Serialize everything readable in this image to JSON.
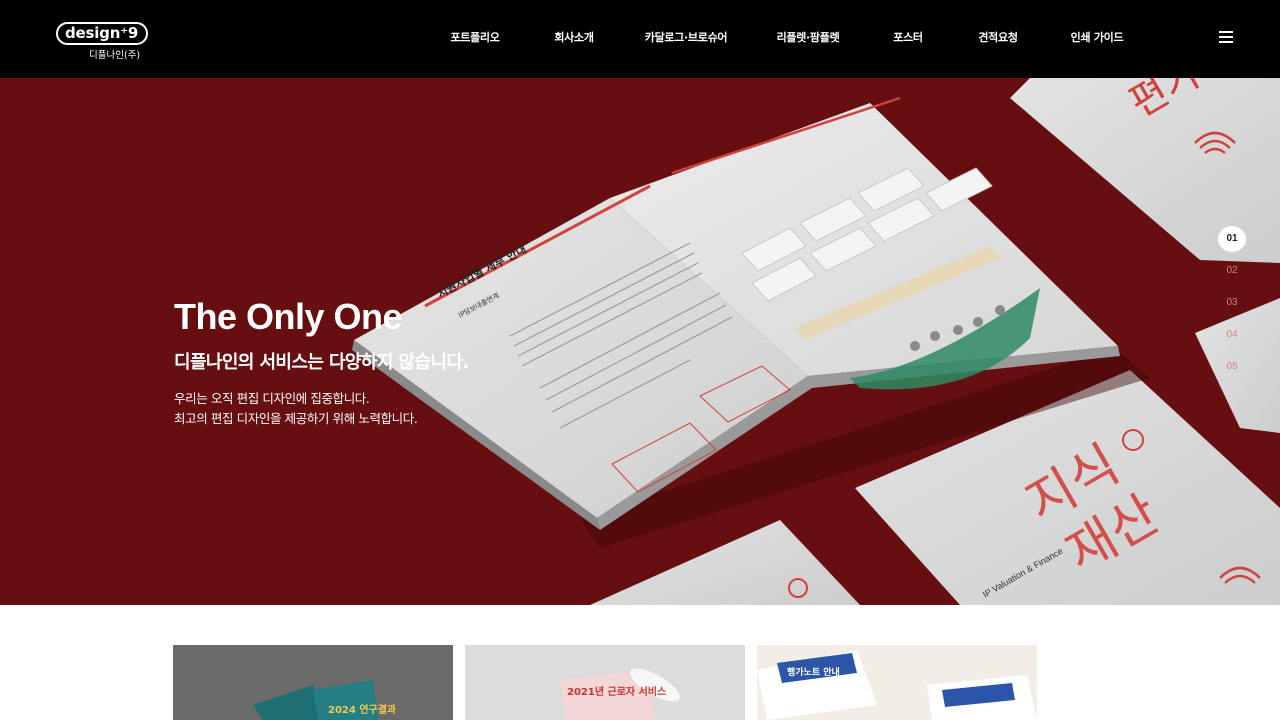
{
  "brand": {
    "logo_text": "design⁺9",
    "logo_subtext": "디플나인(주)"
  },
  "nav": {
    "items": [
      "포트폴리오",
      "회사소개",
      "카달로그·브로슈어",
      "리플렛·팜플렛",
      "포스터",
      "견적요청",
      "인쇄 가이드"
    ],
    "menu_icon": "hamburger-menu-icon"
  },
  "hero": {
    "title": "The Only One",
    "subtitle": "디플나인의 서비스는 다양하지 않습니다.",
    "desc_line1": "우리는 오직 편집 디자인에 집중합니다.",
    "desc_line2": "최고의 편집 디자인을 제공하기 위해 노력합니다.",
    "slides": [
      "01",
      "02",
      "03",
      "04",
      "05"
    ],
    "active_slide": "01",
    "background_color": "#660e10",
    "art_texts": {
      "spread_heading": "지원사업별 세부 안내",
      "spread_sub": "IP담보대출연계",
      "cover_title_en": "IP Valuation & Finance",
      "cover_title_ko": "지식재산 평가지원",
      "cover_big": "지식재산평가"
    }
  },
  "portfolio": {
    "thumbs": [
      {
        "text": "2024 연구결과"
      },
      {
        "text": "2021년 근로자 서비스"
      },
      {
        "text": "행가노트 안내"
      }
    ]
  }
}
